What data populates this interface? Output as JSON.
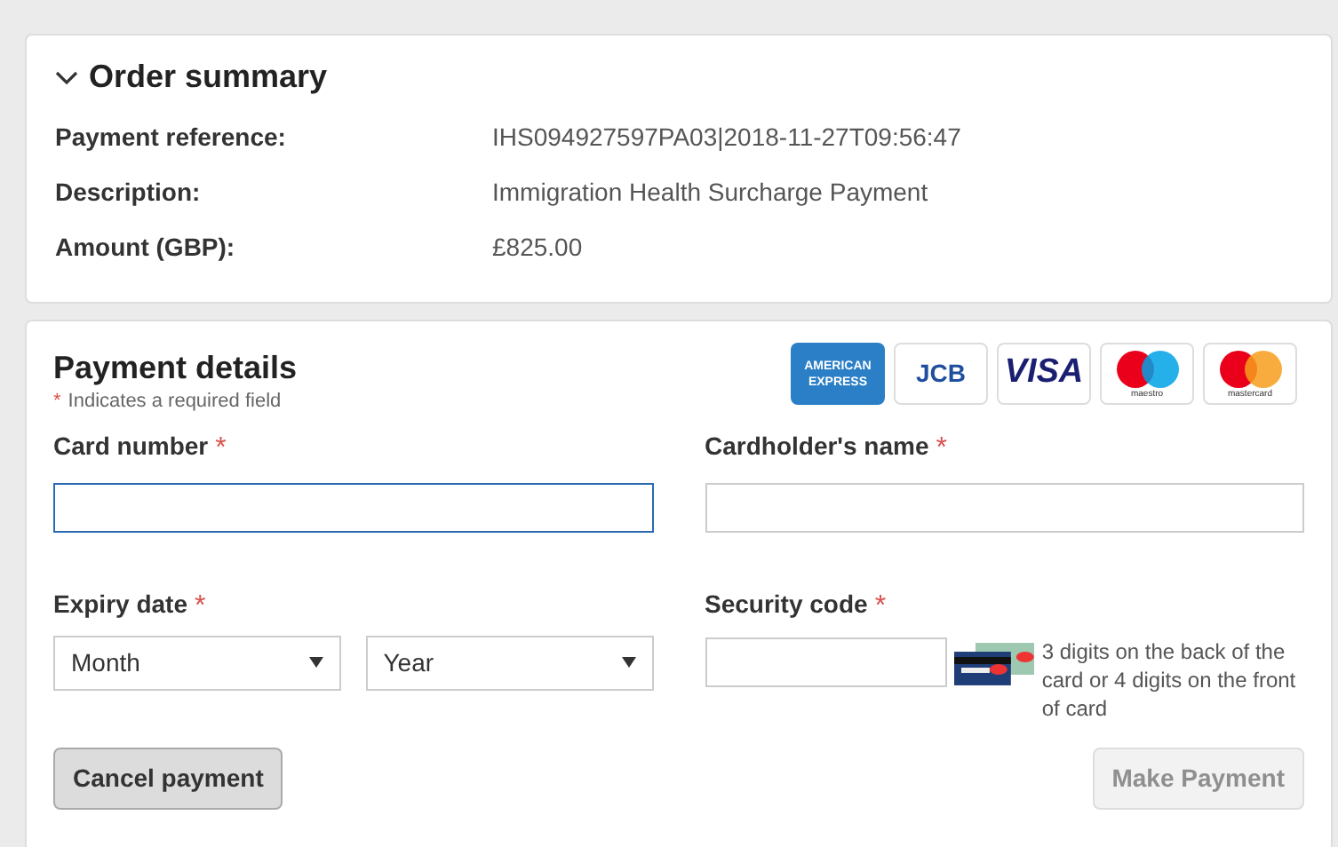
{
  "order_summary": {
    "title": "Order summary",
    "expanded": true,
    "rows": [
      {
        "label": "Payment reference:",
        "value": "IHS094927597PA03|2018-11-27T09:56:47"
      },
      {
        "label": "Description:",
        "value": "Immigration Health Surcharge Payment"
      },
      {
        "label": "Amount (GBP):",
        "value": "£825.00"
      }
    ]
  },
  "payment_details": {
    "title": "Payment details",
    "required_mark": "*",
    "required_note": "Indicates a required field",
    "card_logos": [
      {
        "kind": "amex",
        "text": "AMERICAN EXPRESS"
      },
      {
        "kind": "jcb",
        "text": "JCB"
      },
      {
        "kind": "visa",
        "text": "VISA"
      },
      {
        "kind": "maestro",
        "text": "maestro"
      },
      {
        "kind": "mastercard",
        "text": "mastercard"
      }
    ],
    "card_number": {
      "label": "Card number",
      "required": true,
      "focused": true
    },
    "cardholder_name": {
      "label": "Cardholder's name",
      "required": true,
      "focused": false
    },
    "expiry_date": {
      "label": "Expiry date",
      "required": true,
      "month": "Month",
      "year": "Year"
    },
    "security_code": {
      "label": "Security code",
      "required": true,
      "hint": "3 digits on the back of the card or 4 digits on the front of card"
    },
    "buttons": [
      {
        "label": "Cancel payment",
        "disabled": false
      },
      {
        "label": "Make Payment",
        "disabled": true
      }
    ]
  }
}
